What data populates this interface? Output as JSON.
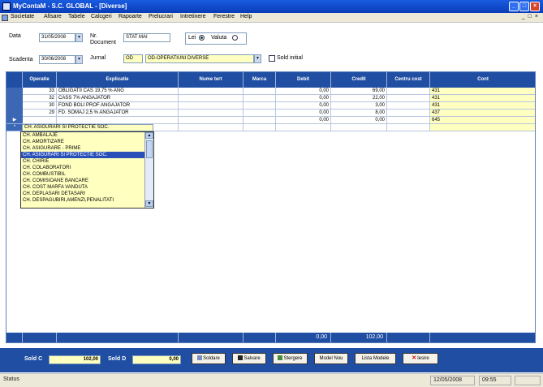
{
  "window": {
    "title": "MyContaM - S.C. GLOBAL - [Diverse]"
  },
  "menu": [
    "Societate",
    "Afisare",
    "Tabele",
    "Calcgeri",
    "Rapoarte",
    "Prelucrari",
    "Intretinere",
    "Ferestre",
    "Help"
  ],
  "form": {
    "data_label": "Data",
    "data_value": "31/05/2008",
    "nr_doc_label_1": "Nr.",
    "nr_doc_label_2": "Document",
    "nr_doc_value": "STAT MAI",
    "lei_label": "Lei",
    "valuta_label": "Valuta",
    "currency_selected": "Lei",
    "scadenta_label": "Scadenta",
    "scadenta_value": "30/06/2008",
    "jurnal_label": "Jurnal",
    "jurnal_code": "OD",
    "jurnal_name": "OD-OPERATIUNI DIVERSE",
    "sold_initial_label": "Sold initial",
    "sold_initial_checked": false
  },
  "grid": {
    "columns": [
      "Operatie",
      "Explicatie",
      "Nume tert",
      "Marca",
      "Debit",
      "Credit",
      "Centru cost",
      "Cont"
    ],
    "rows": [
      {
        "operatie": "33",
        "explicatie": "OBLIGATII CAS 19,75 % ANG",
        "nume_tert": "",
        "marca": "",
        "debit": "0,00",
        "credit": "69,00",
        "centru_cost": "",
        "cont": "431"
      },
      {
        "operatie": "32",
        "explicatie": "CASS 7% ANGAJATOR",
        "nume_tert": "",
        "marca": "",
        "debit": "0,00",
        "credit": "22,00",
        "centru_cost": "",
        "cont": "431"
      },
      {
        "operatie": "30",
        "explicatie": "FOND BOLI PROF ANGAJATOR",
        "nume_tert": "",
        "marca": "",
        "debit": "0,00",
        "credit": "3,00",
        "centru_cost": "",
        "cont": "431"
      },
      {
        "operatie": "29",
        "explicatie": "FD. SOMAJ 2,5 % ANGAJATOR",
        "nume_tert": "",
        "marca": "",
        "debit": "0,00",
        "credit": "8,00",
        "centru_cost": "",
        "cont": "437"
      },
      {
        "operatie": "",
        "explicatie": "",
        "nume_tert": "",
        "marca": "",
        "debit": "0,00",
        "credit": "0,00",
        "centru_cost": "",
        "cont": "645"
      }
    ],
    "totals": {
      "debit": "0,00",
      "credit": "102,00"
    }
  },
  "combo": {
    "value": "CH. ASIGURARI SI PROTECTIE SOC.",
    "items": [
      "CH. AMBALAJE",
      "CH. AMORTIZARE",
      "CH. ASIGURARE - PRIME",
      "CH. ASIGURARI SI PROTECTIE SOC.",
      "CH. CHIRIE",
      "CH. COLABORATORI",
      "CH. COMBUSTIBIL",
      "CH. COMISIOANE BANCARE",
      "CH. COST MARFA VANDUTA",
      "CH. DEPLASARI DETASARI",
      "CH. DESPAGUBIRI,AMENZI,PENALITATI"
    ],
    "selected_index": 3
  },
  "bottom": {
    "sold_c_label": "Sold C",
    "sold_c_value": "102,00",
    "sold_d_label": "Sold D",
    "sold_d_value": "0,00",
    "buttons": [
      "Soldare",
      "Salvare",
      "Stergere",
      "Model Nou",
      "Lista Modele",
      "Iesire"
    ]
  },
  "status": {
    "text": "Status",
    "date": "12/05/2008",
    "time": "09:55"
  },
  "colors": {
    "header_blue": "#1f4ea3",
    "title_blue": "#1a5ce0",
    "yellow": "#ffffc0",
    "select_blue": "#2850b8"
  }
}
